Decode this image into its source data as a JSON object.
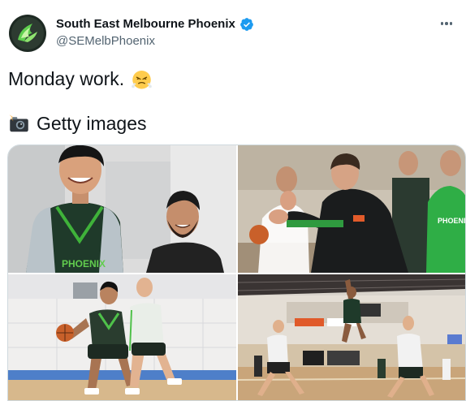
{
  "account": {
    "display_name": "South East Melbourne Phoenix",
    "handle": "@SEMelbPhoenix",
    "verified": true,
    "avatar_icon": "phoenix-logo-icon"
  },
  "tweet": {
    "line1_text": "Monday work.",
    "line1_emoji": "face-with-steam-from-nose",
    "line2_emoji": "camera-with-flash",
    "line2_text": "Getty images"
  },
  "media": {
    "count": 4,
    "photos": [
      {
        "name": "players-laughing-photo"
      },
      {
        "name": "coach-clapping-photo"
      },
      {
        "name": "player-dribbling-photo"
      },
      {
        "name": "player-dunking-photo"
      }
    ],
    "jersey_text": "PHOENIX"
  },
  "colors": {
    "brand_green": "#4fc14a",
    "verified_blue": "#1d9bf0",
    "text_primary": "#0f1419",
    "text_secondary": "#536471"
  }
}
